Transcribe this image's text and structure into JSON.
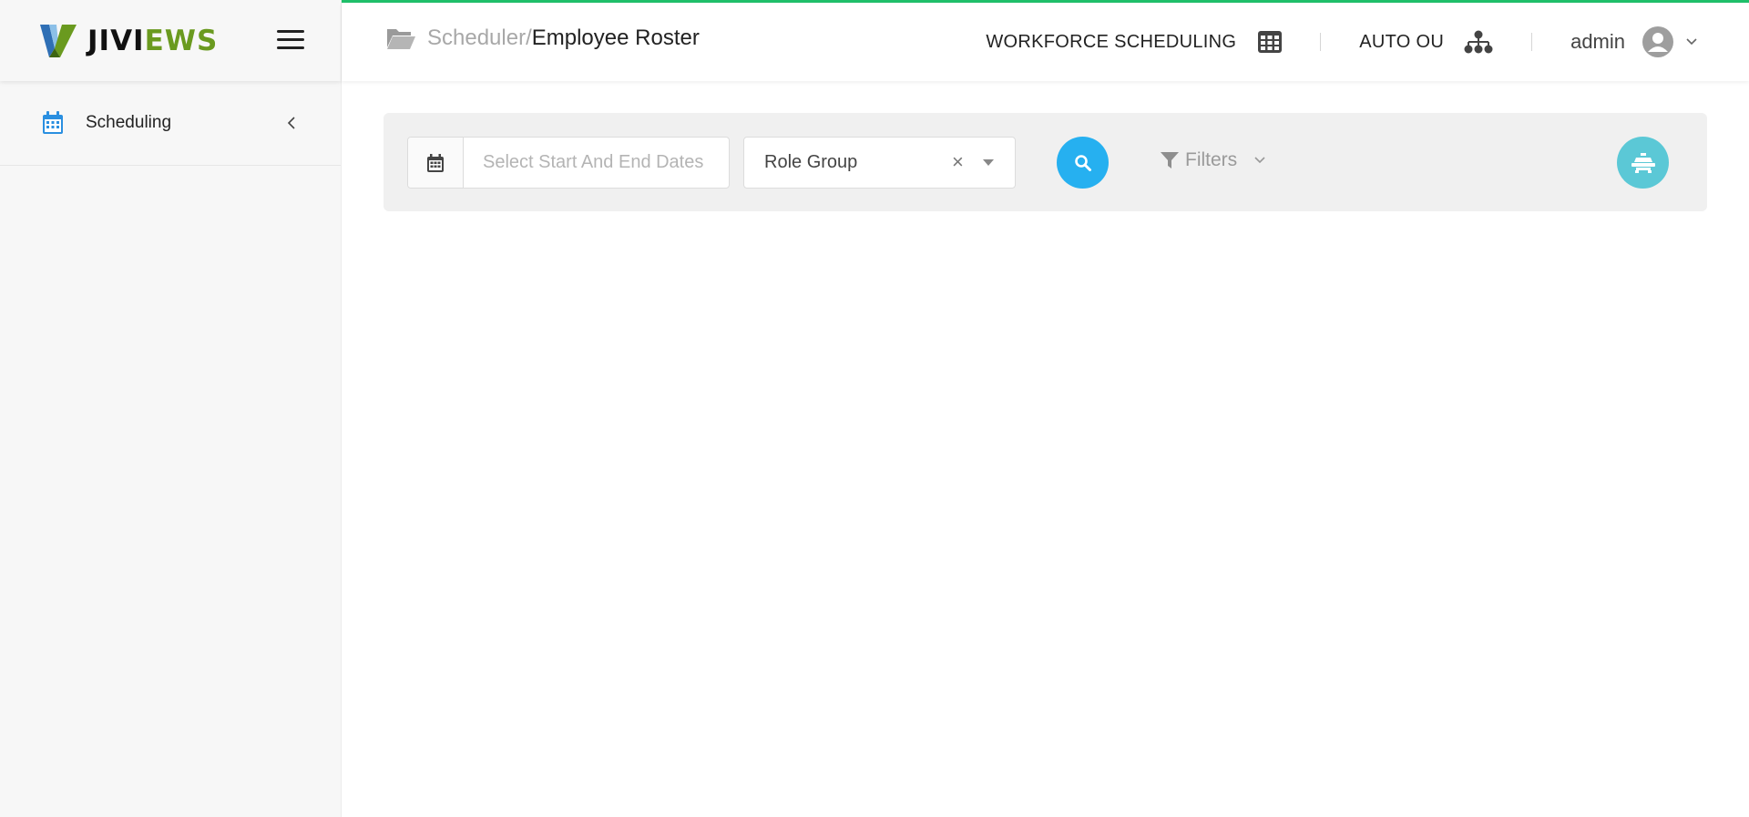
{
  "app": {
    "logo_text_a": "JIVI",
    "logo_text_b": "EWS",
    "accent_color": "#1fbf6a"
  },
  "sidebar": {
    "items": [
      {
        "label": "Scheduling",
        "icon": "calendar-icon"
      }
    ]
  },
  "header": {
    "breadcrumb_parent": "Scheduler",
    "breadcrumb_separator": "/",
    "breadcrumb_current": "Employee Roster",
    "module_label": "WORKFORCE SCHEDULING",
    "module_icon": "grid-icon",
    "ou_label": "AUTO OU",
    "ou_icon": "org-chart-icon",
    "user_name": "admin"
  },
  "filter_bar": {
    "date_placeholder": "Select Start And End Dates",
    "role_group_value": "Role Group",
    "filters_label": "Filters",
    "search_color": "#26b0f0",
    "action_color": "#5bc8d6"
  }
}
